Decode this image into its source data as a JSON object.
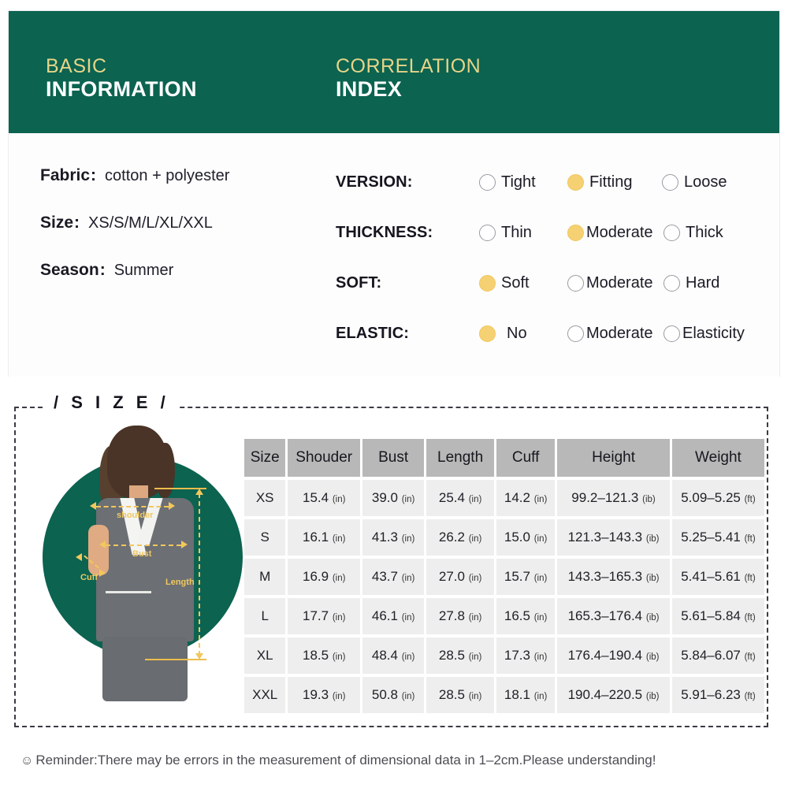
{
  "header": {
    "basic": {
      "line1": "BASIC",
      "line2": "INFORMATION"
    },
    "correlation": {
      "line1": "CORRELATION",
      "line2": "INDEX"
    }
  },
  "basic_info": {
    "rows": [
      {
        "key": "Fabric",
        "colon": ":",
        "value": "cotton + polyester"
      },
      {
        "key": "Size",
        "colon": ":",
        "value": "XS/S/M/L/XL/XXL"
      },
      {
        "key": "Season",
        "colon": ":",
        "value": "Summer"
      }
    ]
  },
  "correlation_index": {
    "rows": [
      {
        "label": "VERSION:",
        "options": [
          {
            "text": "Tight",
            "selected": false
          },
          {
            "text": "Fitting",
            "selected": true
          },
          {
            "text": "Loose",
            "selected": false
          }
        ]
      },
      {
        "label": "THICKNESS:",
        "options": [
          {
            "text": "Thin",
            "selected": false
          },
          {
            "text": "Moderate",
            "selected": true
          },
          {
            "text": "Thick",
            "selected": false
          }
        ]
      },
      {
        "label": "SOFT:",
        "options": [
          {
            "text": "Soft",
            "selected": true
          },
          {
            "text": "Moderate",
            "selected": false
          },
          {
            "text": "Hard",
            "selected": false
          }
        ]
      },
      {
        "label": "ELASTIC:",
        "options": [
          {
            "text": "No",
            "selected": true
          },
          {
            "text": "Moderate",
            "selected": false
          },
          {
            "text": "Elasticity",
            "selected": false
          }
        ]
      }
    ]
  },
  "size_section": {
    "title": "/ S I Z E /",
    "photo_annotations": [
      {
        "label": "shoulder"
      },
      {
        "label": "Bust"
      },
      {
        "label": "Cuff"
      },
      {
        "label": "Length"
      }
    ],
    "table": {
      "columns": [
        "Size",
        "Shouder",
        "Bust",
        "Length",
        "Cuff",
        "Height",
        "Weight"
      ],
      "rows": [
        {
          "size": "XS",
          "shoulder": "15.4",
          "shoulder_unit": "(in)",
          "bust": "39.0",
          "bust_unit": "(in)",
          "length": "25.4",
          "length_unit": "(in)",
          "cuff": "14.2",
          "cuff_unit": "(in)",
          "height": "99.2–121.3",
          "height_unit": "(ib)",
          "weight": "5.09–5.25",
          "weight_unit": "(ft)"
        },
        {
          "size": "S",
          "shoulder": "16.1",
          "shoulder_unit": "(in)",
          "bust": "41.3",
          "bust_unit": "(in)",
          "length": "26.2",
          "length_unit": "(in)",
          "cuff": "15.0",
          "cuff_unit": "(in)",
          "height": "121.3–143.3",
          "height_unit": "(ib)",
          "weight": "5.25–5.41",
          "weight_unit": "(ft)"
        },
        {
          "size": "M",
          "shoulder": "16.9",
          "shoulder_unit": "(in)",
          "bust": "43.7",
          "bust_unit": "(in)",
          "length": "27.0",
          "length_unit": "(in)",
          "cuff": "15.7",
          "cuff_unit": "(in)",
          "height": "143.3–165.3",
          "height_unit": "(ib)",
          "weight": "5.41–5.61",
          "weight_unit": "(ft)"
        },
        {
          "size": "L",
          "shoulder": "17.7",
          "shoulder_unit": "(in)",
          "bust": "46.1",
          "bust_unit": "(in)",
          "length": "27.8",
          "length_unit": "(in)",
          "cuff": "16.5",
          "cuff_unit": "(in)",
          "height": "165.3–176.4",
          "height_unit": "(ib)",
          "weight": "5.61–5.84",
          "weight_unit": "(ft)"
        },
        {
          "size": "XL",
          "shoulder": "18.5",
          "shoulder_unit": "(in)",
          "bust": "48.4",
          "bust_unit": "(in)",
          "length": "28.5",
          "length_unit": "(in)",
          "cuff": "17.3",
          "cuff_unit": "(in)",
          "height": "176.4–190.4",
          "height_unit": "(ib)",
          "weight": "5.84–6.07",
          "weight_unit": "(ft)"
        },
        {
          "size": "XXL",
          "shoulder": "19.3",
          "shoulder_unit": "(in)",
          "bust": "50.8",
          "bust_unit": "(in)",
          "length": "28.5",
          "length_unit": "(in)",
          "cuff": "18.1",
          "cuff_unit": "(in)",
          "height": "190.4–220.5",
          "height_unit": "(ib)",
          "weight": "5.91–6.23",
          "weight_unit": "(ft)"
        }
      ]
    }
  },
  "footer": {
    "smiley": "☺",
    "text": "Reminder:There may be errors in the measurement of dimensional data in 1–2cm.Please understanding!"
  },
  "colors": {
    "brand_green": "#0b6350",
    "gold": "#e6d488",
    "radio_selected": "#f6d173",
    "table_header": "#b8b8b8",
    "table_cell": "#eeeeee",
    "annotation_gold": "#f2c75c"
  }
}
